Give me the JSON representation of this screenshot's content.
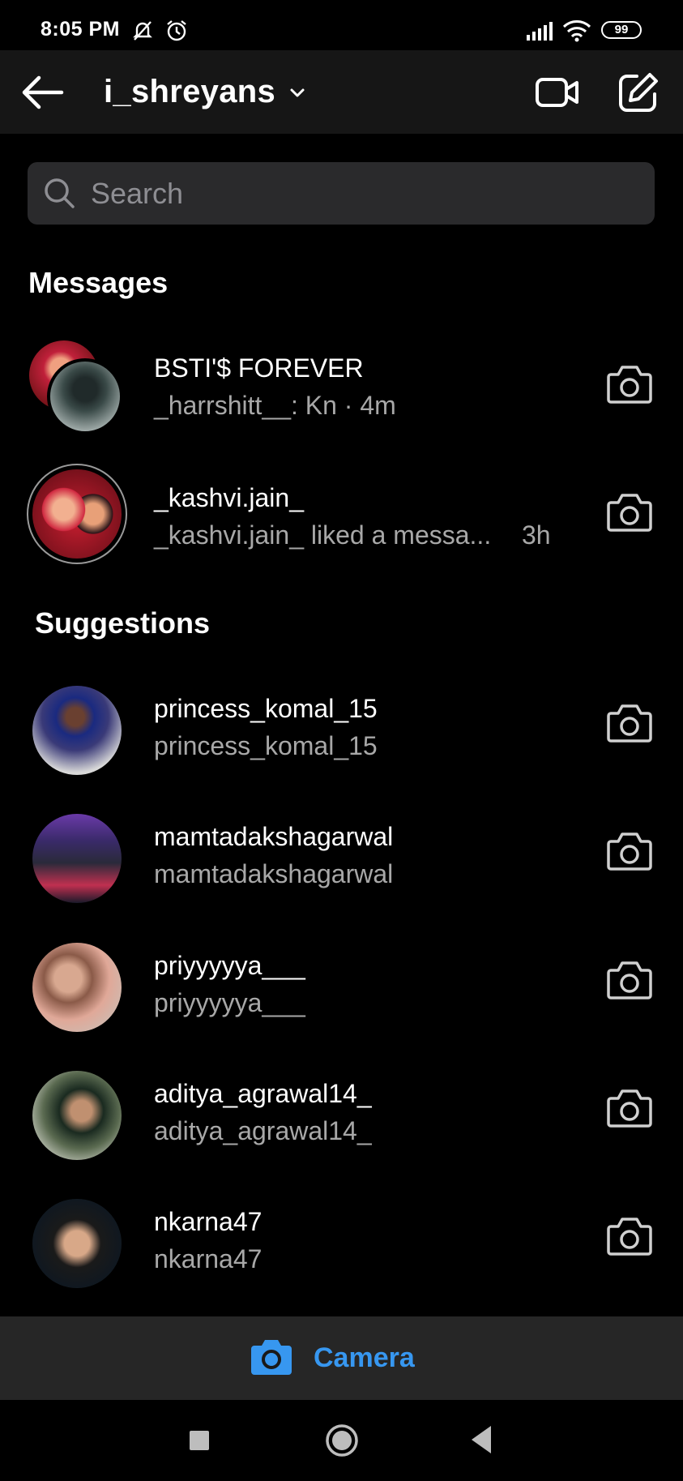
{
  "status_bar": {
    "time": "8:05 PM",
    "battery": "99",
    "icons": [
      "mute-icon",
      "alarm-icon",
      "signal-icon",
      "wifi-icon",
      "battery-icon"
    ]
  },
  "header": {
    "account_name": "i_shreyans",
    "icons": [
      "back-arrow-icon",
      "chevron-down-icon",
      "video-camera-icon",
      "compose-icon"
    ]
  },
  "search": {
    "placeholder": "Search"
  },
  "messages": {
    "title": "Messages",
    "items": [
      {
        "name": "BSTI'$ FOREVER",
        "preview": "_harrshitt__: Kn · 4m"
      },
      {
        "name": "_kashvi.jain_",
        "preview": "_kashvi.jain_ liked a messa...",
        "time": "3h"
      }
    ]
  },
  "suggestions": {
    "title": "Suggestions",
    "items": [
      {
        "name": "princess_komal_15",
        "subtitle": "princess_komal_15"
      },
      {
        "name": "mamtadakshagarwal",
        "subtitle": "mamtadakshagarwal"
      },
      {
        "name": "priyyyyya___",
        "subtitle": "priyyyyya___"
      },
      {
        "name": "aditya_agrawal14_",
        "subtitle": "aditya_agrawal14_"
      },
      {
        "name": "nkarna47",
        "subtitle": "nkarna47"
      }
    ]
  },
  "camera_bar": {
    "label": "Camera"
  },
  "colors": {
    "background": "#000000",
    "header": "#161616",
    "search_bg": "#2a2a2c",
    "secondary_text": "#a8a8a8",
    "accent": "#3797f0",
    "bottom_bar": "#262626"
  }
}
